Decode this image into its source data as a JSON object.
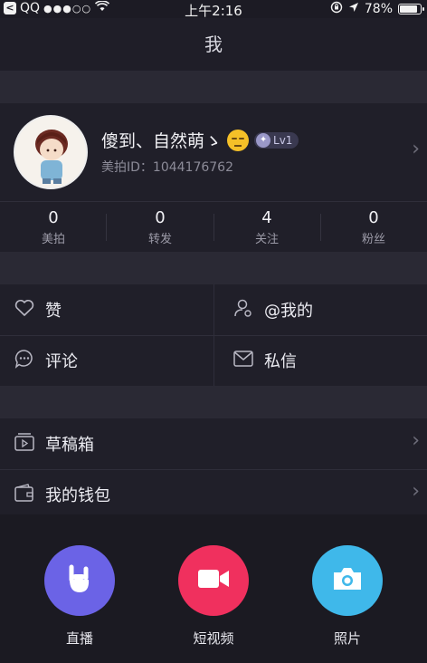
{
  "status_bar": {
    "back_app": "QQ",
    "time": "上午2:16",
    "battery": "78%",
    "battery_level": 0.78
  },
  "nav": {
    "title": "我"
  },
  "profile": {
    "name": "傻到、自然萌ゝ",
    "level": "Lv1",
    "id_label": "美拍ID：",
    "id_value": "1044176762"
  },
  "stats": [
    {
      "value": "0",
      "label": "美拍"
    },
    {
      "value": "0",
      "label": "转发"
    },
    {
      "value": "4",
      "label": "关注"
    },
    {
      "value": "0",
      "label": "粉丝"
    }
  ],
  "grid": {
    "like": "赞",
    "mention": "@我的",
    "comment": "评论",
    "message": "私信"
  },
  "list": {
    "drafts": "草稿箱",
    "wallet": "我的钱包"
  },
  "actions": {
    "live": "直播",
    "short_video": "短视频",
    "photo": "照片"
  },
  "colors": {
    "live": "#6b63e6",
    "short_video": "#f0305e",
    "photo": "#3fb8ea"
  }
}
